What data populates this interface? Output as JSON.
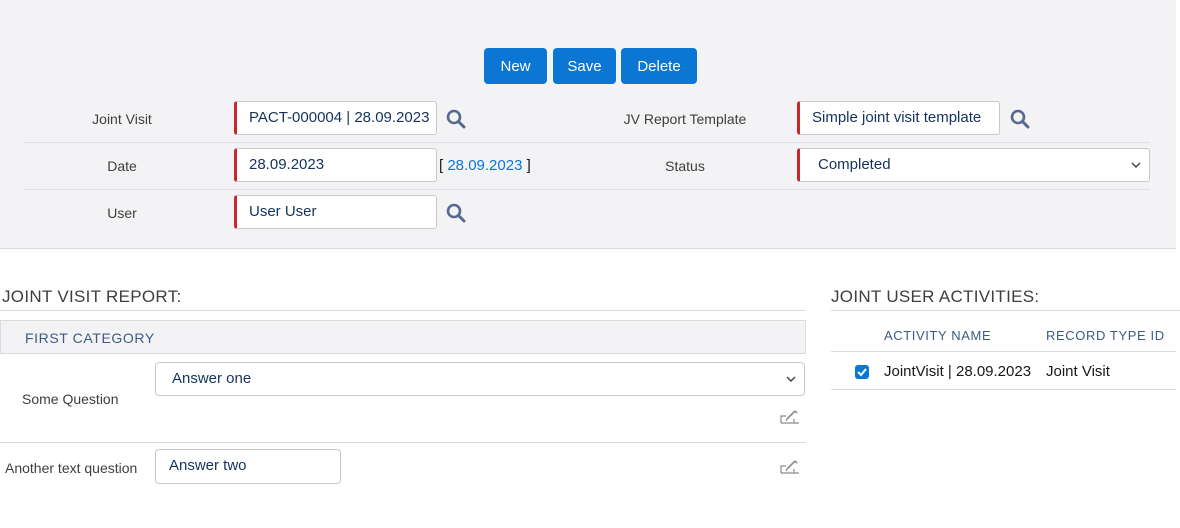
{
  "toolbar": {
    "new_label": "New",
    "save_label": "Save",
    "delete_label": "Delete"
  },
  "form": {
    "joint_visit": {
      "label": "Joint Visit",
      "value": "PACT-000004 | 28.09.2023"
    },
    "date": {
      "label": "Date",
      "value": "28.09.2023",
      "bracket_open": "[",
      "link_value": "28.09.2023",
      "bracket_close": "]"
    },
    "user": {
      "label": "User",
      "value": "User User"
    },
    "template": {
      "label": "JV Report Template",
      "value": "Simple joint visit template"
    },
    "status": {
      "label": "Status",
      "value": "Completed"
    }
  },
  "report": {
    "title": "JOINT VISIT REPORT:",
    "category": "FIRST CATEGORY",
    "questions": [
      {
        "label": "Some Question",
        "answer": "Answer one"
      },
      {
        "label": "Another text question",
        "answer": "Answer two"
      }
    ]
  },
  "activities": {
    "title": "JOINT USER ACTIVITIES:",
    "columns": [
      "ACTIVITY NAME",
      "RECORD TYPE ID"
    ],
    "rows": [
      {
        "checked": true,
        "name": "JointVisit | 28.09.2023",
        "record_type": "Joint Visit"
      }
    ]
  },
  "colors": {
    "accent": "#0b76d3",
    "required": "#c8262c",
    "panel": "#f3f3f5"
  },
  "icons": {
    "lookup": "search-icon",
    "edit": "edit-icon",
    "select": "chevron-down-icon",
    "check": "checkbox-checked-icon"
  }
}
